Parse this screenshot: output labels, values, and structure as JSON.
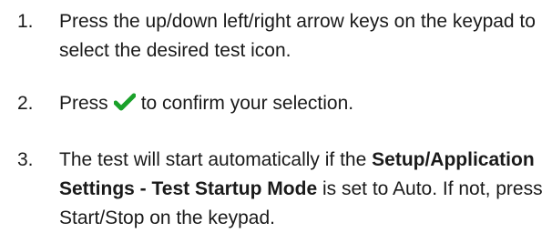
{
  "steps": [
    {
      "number": "1.",
      "text": "Press the up/down left/right arrow keys on the keypad to select the desired test icon."
    },
    {
      "number": "2.",
      "text_before": "Press",
      "icon": "checkmark-icon",
      "icon_color": "#1aa12a",
      "text_after": "to confirm your selection."
    },
    {
      "number": "3.",
      "text_before": "The test will start automatically if the",
      "bold_text": "Setup/Application Settings - Test Startup Mode",
      "text_after": "is set to Auto. If not, press Start/Stop on the keypad."
    }
  ]
}
